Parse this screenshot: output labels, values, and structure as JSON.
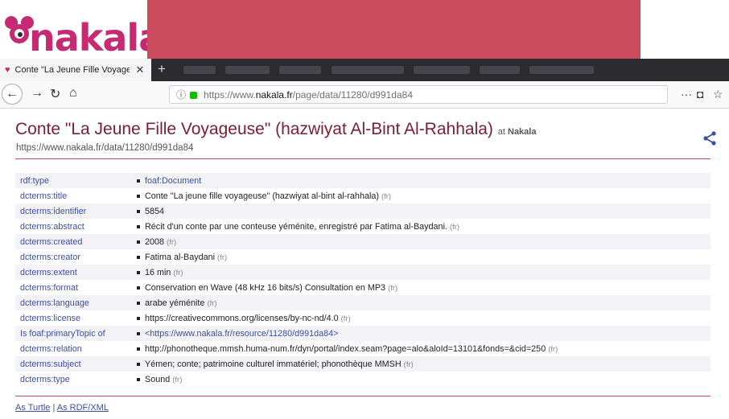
{
  "logo": {
    "text": "nakala"
  },
  "browser": {
    "tab_title": "Conte \"La Jeune Fille Voyageuse\" (haz",
    "tab_close": "✕",
    "new_tab": "+",
    "url_pre": "https://www.",
    "url_host": "nakala.fr",
    "url_post": "/page/data/11280/d991da84"
  },
  "page": {
    "title": "Conte \"La Jeune Fille Voyageuse\" (hazwiyat Al-Bint Al-Rahhala)",
    "title_at": "at",
    "title_site": "Nakala",
    "subtitle": "https://www.nakala.fr/data/11280/d991da84"
  },
  "properties": [
    {
      "predicate": "rdf:type",
      "value": "foaf:Document",
      "lang": "",
      "link": true
    },
    {
      "predicate": "dcterms:title",
      "value": "Conte \"La jeune fille voyageuse\" (hazwiyat al-bint al-rahhala)",
      "lang": "(fr)",
      "link": false
    },
    {
      "predicate": "dcterms:identifier",
      "value": "5854",
      "lang": "",
      "link": false
    },
    {
      "predicate": "dcterms:abstract",
      "value": "Récit d'un conte par une conteuse yéménite, enregistré par Fatima al-Baydani.",
      "lang": "(fr)",
      "link": false
    },
    {
      "predicate": "dcterms:created",
      "value": "2008",
      "lang": "(fr)",
      "link": false
    },
    {
      "predicate": "dcterms:creator",
      "value": "Fatima al-Baydani",
      "lang": "(fr)",
      "link": false
    },
    {
      "predicate": "dcterms:extent",
      "value": "16 min",
      "lang": "(fr)",
      "link": false
    },
    {
      "predicate": "dcterms:format",
      "value": "Conservation en Wave (48 kHz 16 bits/s) Consultation en MP3",
      "lang": "(fr)",
      "link": false
    },
    {
      "predicate": "dcterms:language",
      "value": "arabe yéménite",
      "lang": "(fr)",
      "link": false
    },
    {
      "predicate": "dcterms:license",
      "value": "https://creativecommons.org/licenses/by-nc-nd/4.0",
      "lang": "(fr)",
      "link": false
    },
    {
      "predicate": "Is foaf:primaryTopic of",
      "value": "<https://www.nakala.fr/resource/11280/d991da84>",
      "lang": "",
      "link": true
    },
    {
      "predicate": "dcterms:relation",
      "value": "http://phonotheque.mmsh.huma-num.fr/dyn/portal/index.seam?page=alo&aloId=13101&fonds=&cid=250",
      "lang": "(fr)",
      "link": false
    },
    {
      "predicate": "dcterms:subject",
      "value": "Yémen; conte; patrimoine culturel immatériel; phonothèque MMSH",
      "lang": "(fr)",
      "link": false
    },
    {
      "predicate": "dcterms:type",
      "value": "Sound",
      "lang": "(fr)",
      "link": false
    }
  ],
  "footer": {
    "turtle": "As Turtle",
    "separator": "|",
    "rdfxml": "As RDF/XML"
  },
  "colors": {
    "accent": "#c94b5c",
    "title": "#7a1f30",
    "link": "#3c4fa3",
    "logo": "#c52a72"
  },
  "icons": [
    "pocket-icon",
    "star-icon",
    "more-icon",
    "share-icon",
    "home-icon",
    "reload-icon",
    "back-icon",
    "forward-icon",
    "lock-icon",
    "info-icon"
  ]
}
